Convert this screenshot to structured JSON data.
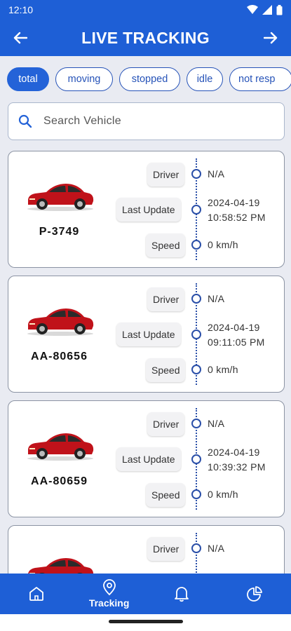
{
  "status": {
    "time": "12:10"
  },
  "header": {
    "title": "LIVE TRACKING"
  },
  "filters": [
    "total",
    "moving",
    "stopped",
    "idle",
    "not resp"
  ],
  "search": {
    "placeholder": "Search Vehicle"
  },
  "labels": {
    "driver": "Driver",
    "last_update": "Last Update",
    "speed": "Speed"
  },
  "vehicles": [
    {
      "plate": "P-3749",
      "driver": "N/A",
      "date": "2024-04-19",
      "time": "10:58:52 PM",
      "speed": "0 km/h"
    },
    {
      "plate": "AA-80656",
      "driver": "N/A",
      "date": "2024-04-19",
      "time": "09:11:05 PM",
      "speed": "0 km/h"
    },
    {
      "plate": "AA-80659",
      "driver": "N/A",
      "date": "2024-04-19",
      "time": "10:39:32 PM",
      "speed": "0 km/h"
    },
    {
      "plate": "",
      "driver": "N/A",
      "date": "",
      "time": "",
      "speed": ""
    }
  ],
  "bottom_nav": {
    "tracking_label": "Tracking"
  },
  "colors": {
    "primary": "#1e5fd6",
    "chip_active": "#2463d8",
    "card_border": "#8b93a3",
    "car_red": "#c0121a"
  }
}
